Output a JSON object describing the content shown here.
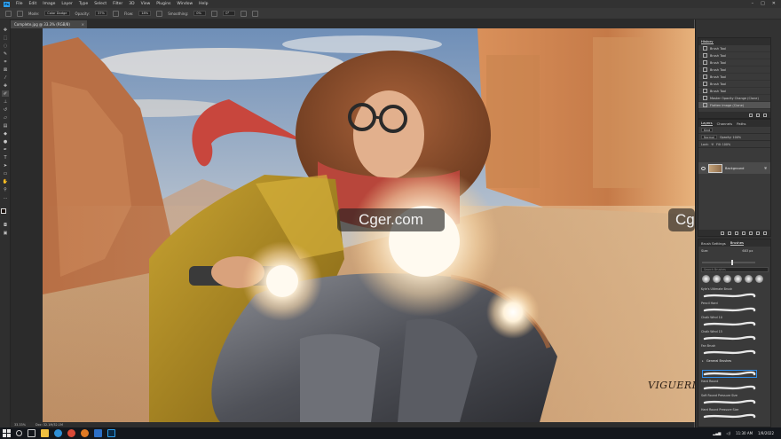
{
  "menubar": {
    "items": [
      "File",
      "Edit",
      "Image",
      "Layer",
      "Type",
      "Select",
      "Filter",
      "3D",
      "View",
      "Plugins",
      "Window",
      "Help"
    ],
    "app_badge": "Ps"
  },
  "options": {
    "mode_label": "Mode:",
    "mode_value": "Color Dodge",
    "opacity_label": "Opacity:",
    "opacity_value": "37%",
    "flow_label": "Flow:",
    "flow_value": "18%",
    "smoothing_label": "Smoothing:",
    "smoothing_value": "0%",
    "angle_value": "0°"
  },
  "document": {
    "tab_title": "Complete.jpg @ 33.3% (RGB/8)",
    "status_zoom": "33.33%",
    "status_doc": "Doc: 32.1M/32.1M"
  },
  "watermarks": [
    "Cger.com",
    "Cger.com"
  ],
  "signature": "VIGUERIE",
  "history": {
    "title": "History",
    "items": [
      {
        "label": "Brush Tool",
        "selected": false
      },
      {
        "label": "Brush Tool",
        "selected": false
      },
      {
        "label": "Brush Tool",
        "selected": false
      },
      {
        "label": "Brush Tool",
        "selected": false
      },
      {
        "label": "Brush Tool",
        "selected": false
      },
      {
        "label": "Brush Tool",
        "selected": false
      },
      {
        "label": "Brush Tool",
        "selected": false
      },
      {
        "label": "Master Opacity Change (Clone)",
        "selected": false
      },
      {
        "label": "Flatten Image (Clone)",
        "selected": true
      }
    ]
  },
  "layers": {
    "tabs": [
      "Layers",
      "Channels",
      "Paths"
    ],
    "kind_label": "Kind",
    "blend_value": "Normal",
    "opacity_label": "Opacity: 100%",
    "lock_label": "Lock:",
    "fill_label": "Fill: 100%",
    "layer_name": "Background"
  },
  "brushes": {
    "tabs": [
      "Brush Settings",
      "Brushes"
    ],
    "size_label": "Size:",
    "size_value": "683 px",
    "search_placeholder": "Search Brushes",
    "size_fraction": 0.55,
    "entries": [
      {
        "name": "Kyle's Ultimate Brush",
        "kind": "brush"
      },
      {
        "name": "Pencil Hard",
        "kind": "brush"
      },
      {
        "name": "Chalk Wind 10",
        "kind": "brush"
      },
      {
        "name": "Chalk Wind 15",
        "kind": "brush"
      },
      {
        "name": "Fan Brush",
        "kind": "brush"
      },
      {
        "name": "General Brushes",
        "kind": "group"
      },
      {
        "name": "",
        "kind": "selected"
      },
      {
        "name": "Hard Round",
        "kind": "brush"
      },
      {
        "name": "Soft Round Pressure Size",
        "kind": "brush"
      },
      {
        "name": "Hard Round Pressure Size",
        "kind": "brush"
      }
    ]
  },
  "taskbar": {
    "time": "11:30 AM",
    "date": "1/9/2022"
  },
  "colors": {
    "accent": "#2d8ceb",
    "foreground": "#1a0f08",
    "background": "#e9d7b8"
  }
}
